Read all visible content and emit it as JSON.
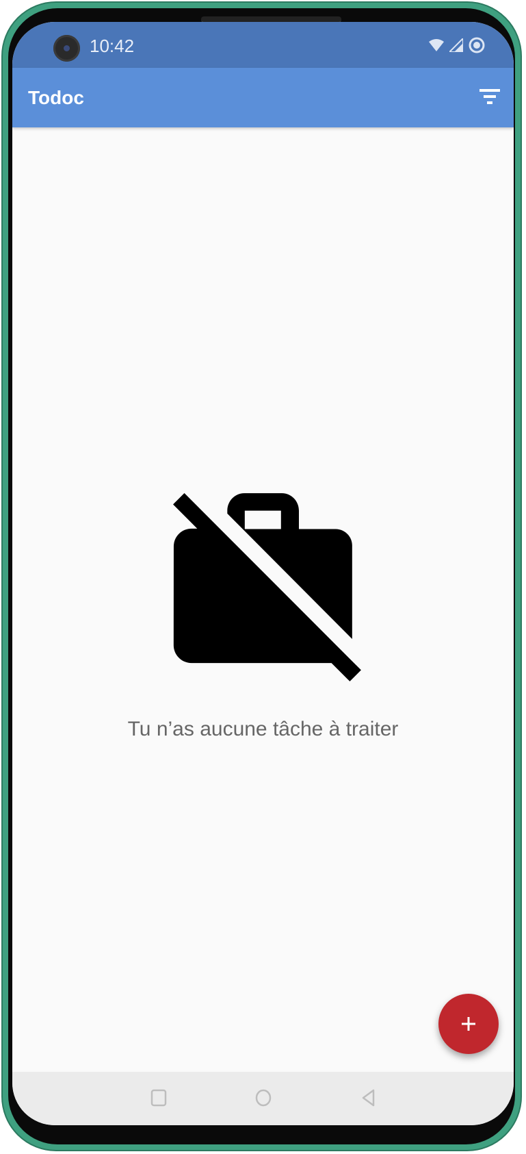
{
  "status_bar": {
    "time": "10:42",
    "icons": [
      "wifi-icon",
      "cellular-signal-icon",
      "sync-circle-icon"
    ]
  },
  "app_bar": {
    "title": "Todoc",
    "filter_icon": "filter-list-icon"
  },
  "empty_state": {
    "icon": "work-off-icon",
    "message": "Tu n’as aucune tâche à traiter"
  },
  "fab": {
    "icon": "plus-icon",
    "label": "+"
  },
  "nav_bar": {
    "buttons": [
      "recents-square-icon",
      "home-circle-icon",
      "back-triangle-icon"
    ]
  },
  "colors": {
    "status_bar": "#4a76b8",
    "app_bar": "#5b8fd9",
    "fab": "#c0272d",
    "background": "#fafafa"
  }
}
